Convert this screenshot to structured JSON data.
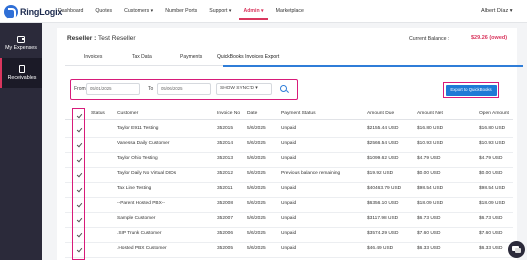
{
  "nav": {
    "logo": "RingLogix",
    "items": [
      {
        "label": "Dashboard"
      },
      {
        "label": "Quotes"
      },
      {
        "label": "Customers ▾"
      },
      {
        "label": "Number Ports"
      },
      {
        "label": "Support ▾"
      },
      {
        "label": "Admin ▾"
      },
      {
        "label": "Marketplace"
      }
    ],
    "active": "Admin ▾",
    "user": "Albert Díaz  ▾"
  },
  "sidebar": {
    "items": [
      {
        "label": "My Expenses",
        "icon": "wallet-icon"
      },
      {
        "label": "Receivables",
        "icon": "document-icon"
      }
    ]
  },
  "page": {
    "prefix": "Reseller :",
    "reseller": "Test Reseller",
    "balance_label": "Current Balance :",
    "balance_value": "$29.26 (owed)"
  },
  "tabs": [
    "Invoices",
    "Tax Data",
    "Payments",
    "QuickBooks Invoices Export"
  ],
  "active_tab": "QuickBooks Invoices Export",
  "filter": {
    "from_label": "From",
    "from_value": "05/01/2025",
    "to_label": "To",
    "to_value": "05/06/2025",
    "sync_value": "SHOW SYNC'D ▾"
  },
  "export_button": "Export to QuickBooks",
  "table": {
    "columns": [
      "Status",
      "Customer",
      "Invoice No",
      "Date",
      "Payment Status",
      "Amount Due",
      "Amount Net",
      "Open Amount"
    ],
    "rows": [
      [
        "Taylor E911 Testing",
        "352015",
        "5/6/2025",
        "Unpaid",
        "$2155.44 USD",
        "$16.80 USD",
        "$16.80 USD"
      ],
      [
        "Vanessa Daily Customer",
        "352014",
        "5/6/2025",
        "Unpaid",
        "$2566.54 USD",
        "$10.93 USD",
        "$10.93 USD"
      ],
      [
        "Taylor Ohio Testing",
        "352013",
        "5/6/2025",
        "Unpaid",
        "$1099.62 USD",
        "$4.79 USD",
        "$4.79 USD"
      ],
      [
        "Taylor Daily No Virtual DIDs",
        "352012",
        "5/6/2025",
        "Previous balance remaining",
        "$19.92 USD",
        "$0.00 USD",
        "$0.00 USD"
      ],
      [
        "Tax Line Testing",
        "352011",
        "5/6/2025",
        "Unpaid",
        "$40463.79 USD",
        "$98.54 USD",
        "$98.54 USD"
      ],
      [
        "--Parent Hosted PBX--",
        "352008",
        "5/6/2025",
        "Unpaid",
        "$6356.10 USD",
        "$18.09 USD",
        "$18.09 USD"
      ],
      [
        "Sample Customer",
        "352007",
        "5/6/2025",
        "Unpaid",
        "$3117.98 USD",
        "$6.73 USD",
        "$6.73 USD"
      ],
      [
        ".SIP Trunk Customer",
        "352006",
        "5/6/2025",
        "Unpaid",
        "$3574.29 USD",
        "$7.60 USD",
        "$7.60 USD"
      ],
      [
        ".Hosted PBX Customer",
        "352005",
        "5/6/2025",
        "Unpaid",
        "$46.49 USD",
        "$6.33 USD",
        "$6.33 USD"
      ]
    ]
  },
  "colors": {
    "accent": "#d9365e",
    "highlight": "#d81b7a",
    "primary": "#1f7ad6",
    "sidebar": "#2b2a3a"
  }
}
